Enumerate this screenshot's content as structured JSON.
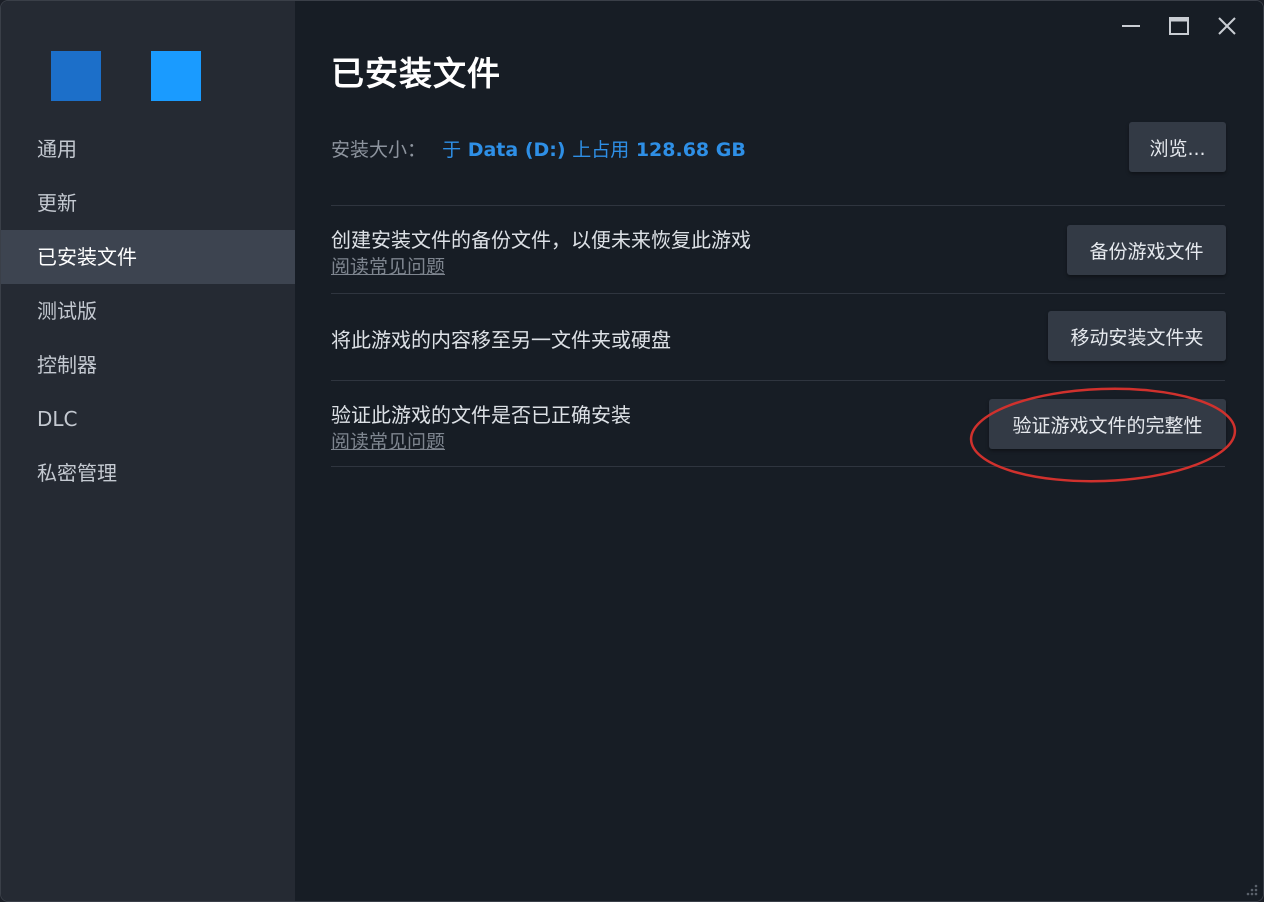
{
  "colors": {
    "sidebar_bg": "#252a33",
    "main_bg": "#171d25",
    "active_nav_bg": "#3d4450",
    "accent_blue": "#2e8fe6",
    "logo_left": "#1c6fc9",
    "logo_right": "#1a9bff",
    "annotation_red": "#d0312d"
  },
  "window_controls": {
    "minimize_icon": "minimize-icon",
    "maximize_icon": "maximize-icon",
    "close_icon": "close-icon"
  },
  "sidebar": {
    "items": [
      {
        "label": "通用"
      },
      {
        "label": "更新"
      },
      {
        "label": "已安装文件",
        "active": true
      },
      {
        "label": "测试版"
      },
      {
        "label": "控制器"
      },
      {
        "label": "DLC"
      },
      {
        "label": "私密管理"
      }
    ]
  },
  "main": {
    "title": "已安装文件",
    "install_size": {
      "label": "安装大小：",
      "prefix": "于",
      "drive": "Data (D:)",
      "middle": "上占用",
      "size": "128.68 GB",
      "browse_button": "浏览..."
    },
    "backup": {
      "text": "创建安装文件的备份文件，以便未来恢复此游戏",
      "link": "阅读常见问题",
      "button": "备份游戏文件"
    },
    "move": {
      "text": "将此游戏的内容移至另一文件夹或硬盘",
      "button": "移动安装文件夹"
    },
    "verify": {
      "text": "验证此游戏的文件是否已正确安装",
      "link": "阅读常见问题",
      "button": "验证游戏文件的完整性"
    }
  }
}
